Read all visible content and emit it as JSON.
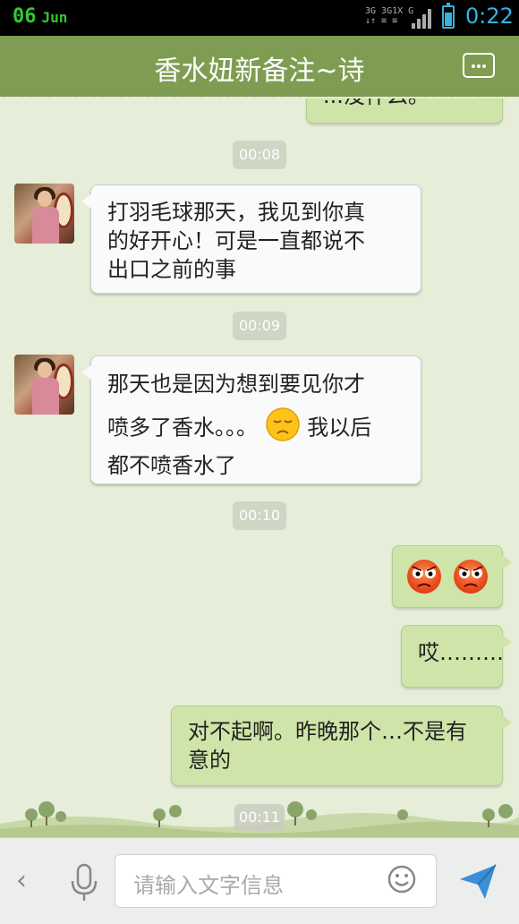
{
  "status_bar": {
    "date_day": "06",
    "date_month": "Jun",
    "network_top": "3G 3G1X G",
    "network_bottom": "↓↑ ≡ ≡",
    "time": "0:22",
    "signal_icon": "signal-bars-icon",
    "battery_icon": "battery-icon"
  },
  "header": {
    "title": "香水妞新备注~诗",
    "menu_icon": "more-dots-icon"
  },
  "messages": [
    {
      "type": "out_partial",
      "text": "...没什么。"
    },
    {
      "type": "timestamp",
      "text": "00:08"
    },
    {
      "type": "in",
      "lines": [
        "打羽毛球那天，我见到你真",
        "的好开心！可是一直都说不",
        "出口之前的事"
      ]
    },
    {
      "type": "timestamp",
      "text": "00:09"
    },
    {
      "type": "in",
      "line1": "那天也是因为想到要见你才",
      "line2_before": "喷多了香水。。。",
      "line2_after": "我以后",
      "line3": "都不喷香水了",
      "emoji": "sad-face-emoji"
    },
    {
      "type": "timestamp",
      "text": "00:10"
    },
    {
      "type": "out",
      "emoji": "angry-face-emoji",
      "count": 2
    },
    {
      "type": "out",
      "text": "哎………"
    },
    {
      "type": "out",
      "lines": [
        "对不起啊。昨晚那个…不是有",
        "意的"
      ]
    },
    {
      "type": "timestamp",
      "text": "00:11"
    }
  ],
  "input_bar": {
    "back_icon": "chevron-left-icon",
    "mic_icon": "microphone-icon",
    "placeholder": "请输入文字信息",
    "emoji_icon": "smiley-icon",
    "send_icon": "send-arrow-icon"
  },
  "colors": {
    "header": "#7e9d52",
    "chat_background": "#e6edd8",
    "outgoing_bubble": "#cfe4a8",
    "incoming_bubble": "#fafafa",
    "time_accent": "#3ab0e0",
    "date_accent": "#32c832"
  }
}
